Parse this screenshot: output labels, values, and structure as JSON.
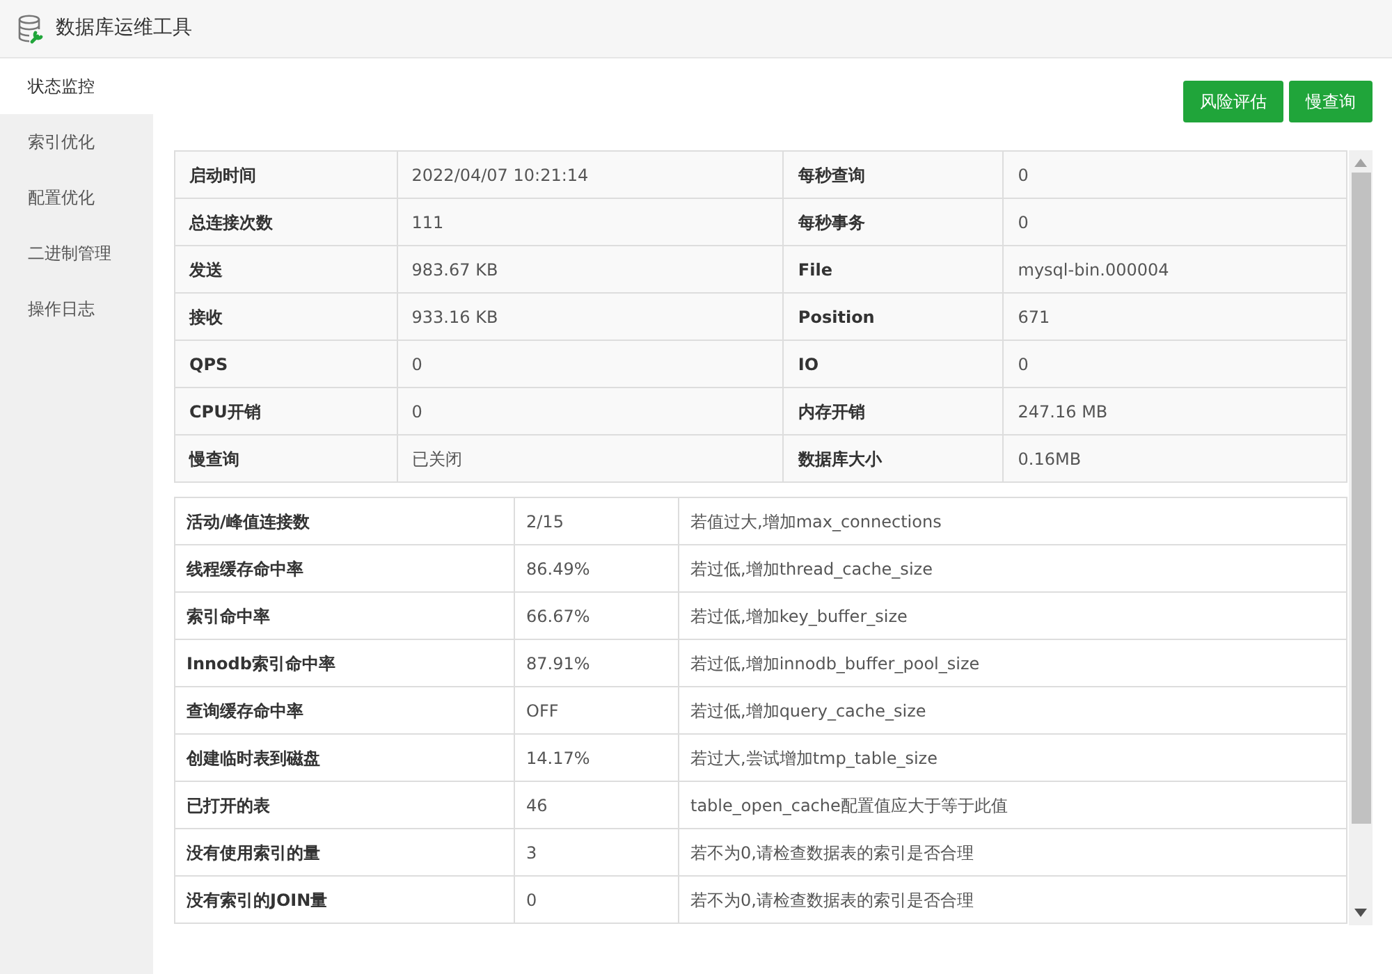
{
  "window": {
    "title": "数据库运维工具"
  },
  "sidebar": {
    "items": [
      {
        "label": "状态监控",
        "selected": true
      },
      {
        "label": "索引优化",
        "selected": false
      },
      {
        "label": "配置优化",
        "selected": false
      },
      {
        "label": "二进制管理",
        "selected": false
      },
      {
        "label": "操作日志",
        "selected": false
      }
    ]
  },
  "buttons": [
    "风险评估",
    "慢查询"
  ],
  "status_table": {
    "rows": [
      [
        "启动时间",
        "2022/04/07 10:21:14",
        "每秒查询",
        "0"
      ],
      [
        "总连接次数",
        "111",
        "每秒事务",
        "0"
      ],
      [
        "发送",
        "983.67 KB",
        "File",
        "mysql-bin.000004"
      ],
      [
        "接收",
        "933.16 KB",
        "Position",
        "671"
      ],
      [
        "QPS",
        "0",
        "IO",
        "0"
      ],
      [
        "CPU开销",
        "0",
        "内存开销",
        "247.16 MB"
      ],
      [
        "慢查询",
        "已关闭",
        "数据库大小",
        "0.16MB"
      ]
    ]
  },
  "metrics_table": {
    "rows": [
      [
        "活动/峰值连接数",
        "2/15",
        "若值过大,增加max_connections"
      ],
      [
        "线程缓存命中率",
        "86.49%",
        "若过低,增加thread_cache_size"
      ],
      [
        "索引命中率",
        "66.67%",
        "若过低,增加key_buffer_size"
      ],
      [
        "Innodb索引命中率",
        "87.91%",
        "若过低,增加innodb_buffer_pool_size"
      ],
      [
        "查询缓存命中率",
        "OFF",
        "若过低,增加query_cache_size"
      ],
      [
        "创建临时表到磁盘",
        "14.17%",
        "若过大,尝试增加tmp_table_size"
      ],
      [
        "已打开的表",
        "46",
        "table_open_cache配置值应大于等于此值"
      ],
      [
        "没有使用索引的量",
        "3",
        "若不为0,请检查数据表的索引是否合理"
      ],
      [
        "没有索引的JOIN量",
        "0",
        "若不为0,请检查数据表的索引是否合理"
      ]
    ]
  }
}
